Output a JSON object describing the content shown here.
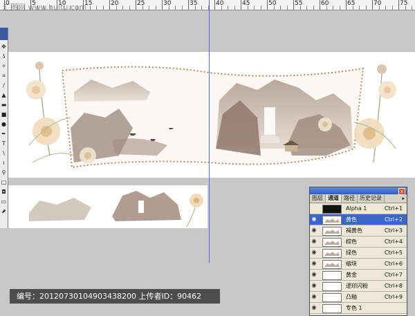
{
  "watermark": {
    "site": "汇图网 www.huitu.com"
  },
  "ruler": {
    "labels": [
      "0",
      "5",
      "10",
      "15",
      "20",
      "25",
      "30",
      "35",
      "40",
      "45",
      "50",
      "55",
      "60",
      "65",
      "70",
      "75"
    ]
  },
  "toolbox": {
    "tools": [
      "move-tool",
      "lasso-tool",
      "magic-wand-tool",
      "crop-tool",
      "brush-tool",
      "stamp-tool",
      "eraser-tool",
      "gradient-tool",
      "dodge-tool",
      "pen-tool",
      "type-tool",
      "shape-tool",
      "eyedropper-tool",
      "zoom-tool",
      "hand-tool",
      "color-swatch",
      "quickmask-tool",
      "screen-mode-tool"
    ]
  },
  "panel": {
    "tabs": [
      "图层",
      "通道",
      "路径",
      "历史记录"
    ],
    "active_tab": "通道",
    "menu_arrow": "▸",
    "close": "x",
    "channels": [
      {
        "name": "Alpha 1",
        "shortcut": "Ctrl+1",
        "visible": false,
        "thumb": "black"
      },
      {
        "name": "黄色",
        "shortcut": "Ctrl+2",
        "visible": true,
        "thumb": "art",
        "selected": true
      },
      {
        "name": "褐黄色",
        "shortcut": "Ctrl+3",
        "visible": true,
        "thumb": "art"
      },
      {
        "name": "棕色",
        "shortcut": "Ctrl+4",
        "visible": true,
        "thumb": "art"
      },
      {
        "name": "绿色",
        "shortcut": "Ctrl+5",
        "visible": true,
        "thumb": "art"
      },
      {
        "name": "缩块",
        "shortcut": "Ctrl+6",
        "visible": true,
        "thumb": "art"
      },
      {
        "name": "黄金",
        "shortcut": "Ctrl+7",
        "visible": true,
        "thumb": "white"
      },
      {
        "name": "逻印闪粉",
        "shortcut": "Ctrl+8",
        "visible": true,
        "thumb": "white"
      },
      {
        "name": "凸釉",
        "shortcut": "Ctrl+9",
        "visible": true,
        "thumb": "white"
      },
      {
        "name": "专色 1",
        "shortcut": "",
        "visible": true,
        "thumb": "white"
      }
    ]
  },
  "infobar": {
    "text": "编号：20120730104903438200 上传者ID：90462"
  },
  "colors": {
    "workspace": "#c7c7c7",
    "selected_row": "#3a66c5",
    "panel_bg": "#ece9d8",
    "art_brown": "#9b8677",
    "art_orange": "#e8c9a0"
  }
}
